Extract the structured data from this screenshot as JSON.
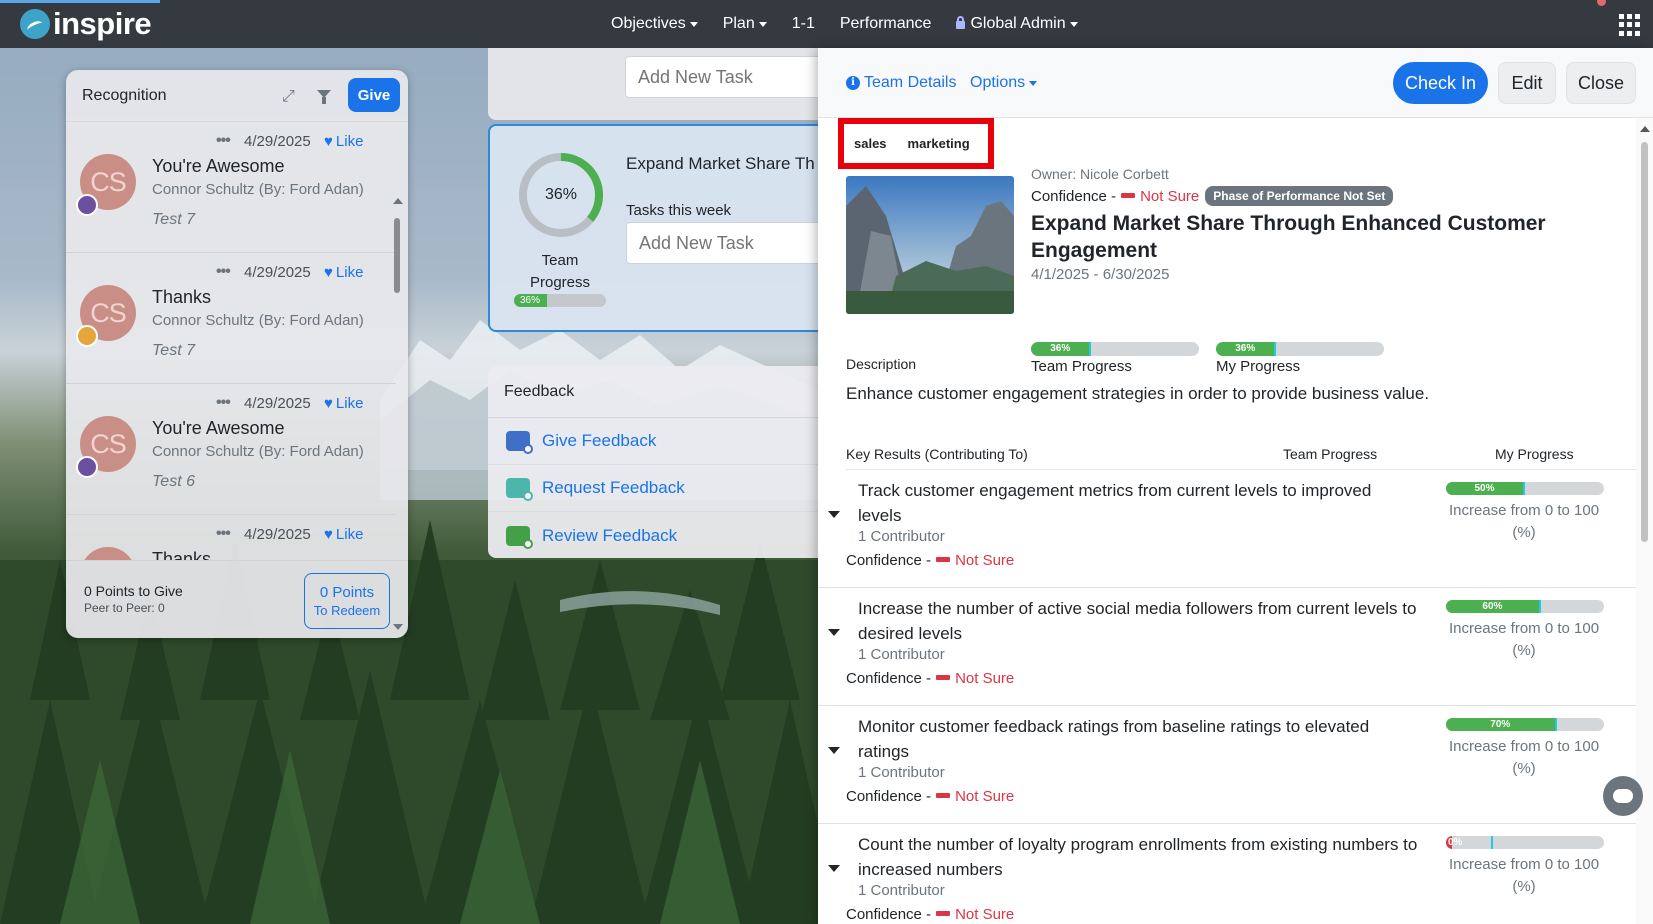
{
  "colors": {
    "primary": "#1a73e8",
    "navbar": "#343a40",
    "progress": "#4caf50",
    "danger": "#dc3545",
    "highlight": "#e8000b"
  },
  "navbar": {
    "brand": "inspire",
    "items": [
      "Objectives",
      "Plan",
      "1-1",
      "Performance",
      "Global Admin"
    ],
    "apps_icon": "grid-icon"
  },
  "recognition": {
    "title": "Recognition",
    "give_label": "Give",
    "items": [
      {
        "date": "4/29/2025",
        "like": "Like",
        "initials": "CS",
        "title": "You're Awesome",
        "from": "Connor Schultz (By: Ford Adan)",
        "note": "Test 7"
      },
      {
        "date": "4/29/2025",
        "like": "Like",
        "initials": "CS",
        "title": "Thanks",
        "from": "Connor Schultz (By: Ford Adan)",
        "note": "Test 7"
      },
      {
        "date": "4/29/2025",
        "like": "Like",
        "initials": "CS",
        "title": "You're Awesome",
        "from": "Connor Schultz (By: Ford Adan)",
        "note": "Test 6"
      },
      {
        "date": "4/29/2025",
        "like": "Like",
        "initials": "CS",
        "title": "Thanks",
        "from": "",
        "note": ""
      }
    ],
    "points_to_give": "0 Points to Give",
    "peer_to_peer": "Peer to Peer: 0",
    "points": "0 Points",
    "to_redeem": "To Redeem"
  },
  "tasks": {
    "add_placeholder": "Add New Task",
    "team_title": "Expand Market Share Th",
    "tasks_this_week": "Tasks this week",
    "team_progress_pct": "36%",
    "team_progress_value": 36,
    "team_progress_label": "Team Progress"
  },
  "feedback": {
    "title": "Feedback",
    "items": [
      "Give Feedback",
      "Request Feedback",
      "Review Feedback"
    ]
  },
  "panel": {
    "team_details": "Team Details",
    "options": "Options",
    "check_in": "Check In",
    "edit": "Edit",
    "close": "Close",
    "tags": [
      "sales",
      "marketing"
    ],
    "owner": "Owner: Nicole Corbett",
    "confidence_label": "Confidence -",
    "confidence_value": "Not Sure",
    "phase": "Phase of Performance Not Set",
    "title": "Expand Market Share Through Enhanced Customer Engagement",
    "dates": "4/1/2025 - 6/30/2025",
    "team_progress": {
      "label": "Team Progress",
      "text": "36%",
      "value": 36
    },
    "my_progress": {
      "label": "My Progress",
      "text": "36%",
      "value": 36
    },
    "description_heading": "Description",
    "description": "Enhance customer engagement strategies in order to provide business value.",
    "kr_headers": {
      "key_results": "Key Results (Contributing To)",
      "team": "Team Progress",
      "mine": "My Progress"
    },
    "key_results": [
      {
        "title": "Track customer engagement metrics from current levels to improved levels",
        "contributors": "1 Contributor",
        "confidence_label": "Confidence -",
        "confidence": "Not Sure",
        "pct_text": "50%",
        "pct": 50,
        "increase": "Increase from 0 to 100 (%)"
      },
      {
        "title": "Increase the number of active social media followers from current levels to desired levels",
        "contributors": "1 Contributor",
        "confidence_label": "Confidence -",
        "confidence": "Not Sure",
        "pct_text": "60%",
        "pct": 60,
        "increase": "Increase from 0 to 100 (%)"
      },
      {
        "title": "Monitor customer feedback ratings from baseline ratings to elevated ratings",
        "contributors": "1 Contributor",
        "confidence_label": "Confidence -",
        "confidence": "Not Sure",
        "pct_text": "70%",
        "pct": 70,
        "increase": "Increase from 0 to 100 (%)"
      },
      {
        "title": "Count the number of loyalty program enrollments from existing numbers to increased numbers",
        "contributors": "1 Contributor",
        "confidence_label": "Confidence -",
        "confidence": "Not Sure",
        "pct_text": "0%",
        "pct": 0,
        "increase": "Increase from 0 to 100 (%)"
      }
    ]
  }
}
